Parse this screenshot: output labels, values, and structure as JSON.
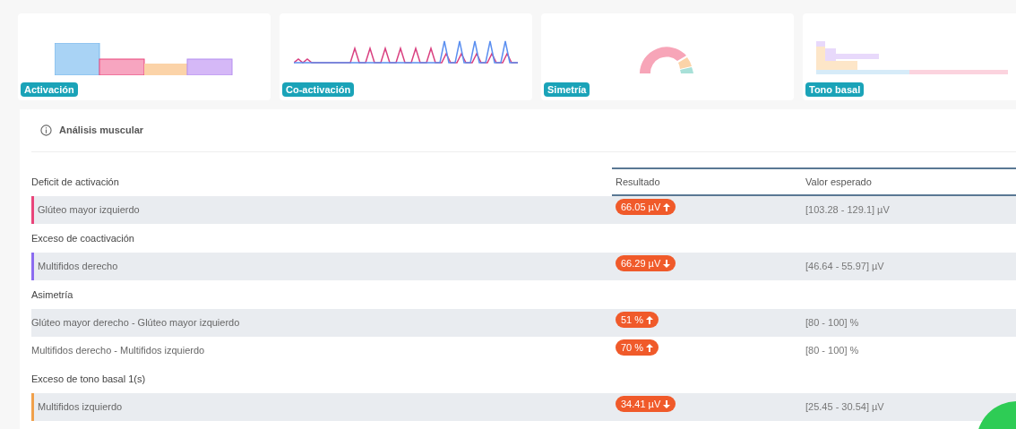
{
  "cards": [
    {
      "kind": "bars",
      "label": "Activación"
    },
    {
      "kind": "waves",
      "label": "Co-activación"
    },
    {
      "kind": "gauge",
      "label": "Simetría"
    },
    {
      "kind": "steps",
      "label": "Tono basal"
    }
  ],
  "panel": {
    "title": "Análisis muscular"
  },
  "table": {
    "columns": [
      "Resultado",
      "Valor esperado"
    ],
    "groups": [
      {
        "title": "Deficit de activación",
        "rows": [
          {
            "name": "Glúteo mayor izquierdo",
            "color": "#e9457a",
            "shaded": true,
            "result": "66.05 µV",
            "rising": true,
            "expected": "[103.28 - 129.1] µV"
          }
        ]
      },
      {
        "title": "Exceso de coactivación",
        "rows": [
          {
            "name": "Multifidos derecho",
            "color": "#8b6cf0",
            "shaded": true,
            "result": "66.29 µV",
            "rising": false,
            "expected": "[46.64 - 55.97] µV"
          }
        ]
      },
      {
        "title": "Asimetría",
        "rows": [
          {
            "name": "Glúteo mayor derecho - Glúteo mayor izquierdo",
            "shaded": true,
            "result": "51 %",
            "rising": true,
            "expected": "[80 - 100] %"
          },
          {
            "name": "Multifidos derecho - Multifidos izquierdo",
            "shaded": false,
            "result": "70 %",
            "rising": true,
            "expected": "[80 - 100] %"
          }
        ]
      },
      {
        "title": "Exceso de tono basal 1(s)",
        "rows": [
          {
            "name": "Multifidos izquierdo",
            "color": "#f0a04b",
            "shaded": true,
            "result": "34.41 µV",
            "rising": false,
            "expected": "[25.45 - 30.54] µV"
          }
        ]
      }
    ]
  }
}
